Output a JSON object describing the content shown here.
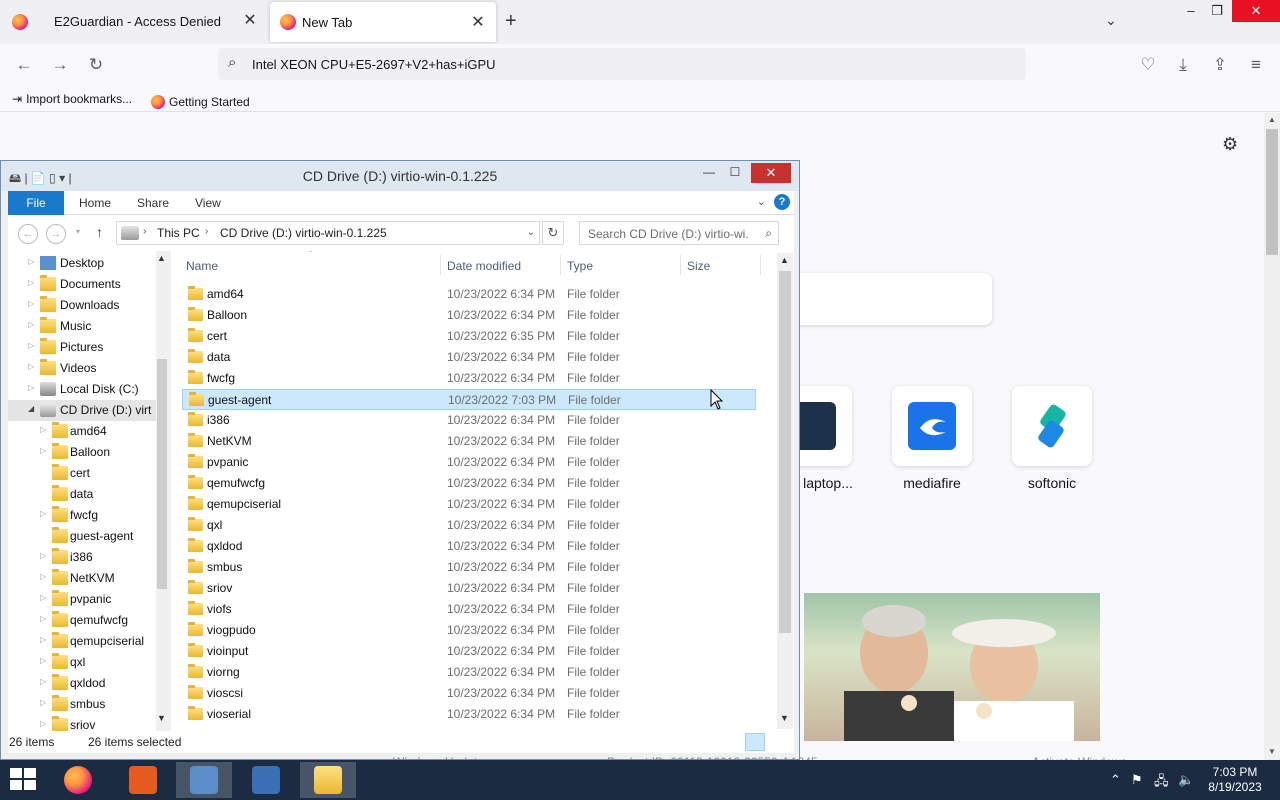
{
  "browser": {
    "tabs": [
      {
        "title": "E2Guardian - Access Denied",
        "active": false
      },
      {
        "title": "New Tab",
        "active": true
      }
    ],
    "new_tab": "+",
    "address": "Intel XEON CPU+E5-2697+V2+has+iGPU",
    "bookmarks": [
      {
        "label": "Import bookmarks..."
      },
      {
        "label": "Getting Started"
      }
    ]
  },
  "newtab_page": {
    "shortcuts": [
      {
        "label": "laptop...",
        "color": "#1d3049"
      },
      {
        "label": "mediafire",
        "color": "#1a73e8"
      },
      {
        "label": "softonic",
        "color": "#16b7a2"
      }
    ],
    "footer_left": "Windows Update",
    "footer_mid": "Product ID: 00118-10010-32552-AA245",
    "footer_right": "Activate Windows"
  },
  "explorer": {
    "title": "CD Drive (D:) virtio-win-0.1.225",
    "ribbon_tabs": [
      "File",
      "Home",
      "Share",
      "View"
    ],
    "breadcrumb": [
      "This PC",
      "CD Drive (D:) virtio-win-0.1.225"
    ],
    "search_placeholder": "Search CD Drive (D:) virtio-wi...",
    "nav_top": [
      {
        "label": "Desktop"
      },
      {
        "label": "Documents"
      },
      {
        "label": "Downloads"
      },
      {
        "label": "Music"
      },
      {
        "label": "Pictures"
      },
      {
        "label": "Videos"
      },
      {
        "label": "Local Disk (C:)"
      },
      {
        "label": "CD Drive (D:) virt"
      }
    ],
    "nav_children": [
      {
        "label": "amd64"
      },
      {
        "label": "Balloon"
      },
      {
        "label": "cert"
      },
      {
        "label": "data"
      },
      {
        "label": "fwcfg"
      },
      {
        "label": "guest-agent"
      },
      {
        "label": "i386"
      },
      {
        "label": "NetKVM"
      },
      {
        "label": "pvpanic"
      },
      {
        "label": "qemufwcfg"
      },
      {
        "label": "qemupciserial"
      },
      {
        "label": "qxl"
      },
      {
        "label": "qxldod"
      },
      {
        "label": "smbus"
      },
      {
        "label": "sriov"
      }
    ],
    "columns": [
      "Name",
      "Date modified",
      "Type",
      "Size"
    ],
    "files": [
      {
        "name": "amd64",
        "date": "10/23/2022 6:34 PM",
        "type": "File folder"
      },
      {
        "name": "Balloon",
        "date": "10/23/2022 6:34 PM",
        "type": "File folder"
      },
      {
        "name": "cert",
        "date": "10/23/2022 6:35 PM",
        "type": "File folder"
      },
      {
        "name": "data",
        "date": "10/23/2022 6:34 PM",
        "type": "File folder"
      },
      {
        "name": "fwcfg",
        "date": "10/23/2022 6:34 PM",
        "type": "File folder"
      },
      {
        "name": "guest-agent",
        "date": "10/23/2022 7:03 PM",
        "type": "File folder",
        "selected": true
      },
      {
        "name": "i386",
        "date": "10/23/2022 6:34 PM",
        "type": "File folder"
      },
      {
        "name": "NetKVM",
        "date": "10/23/2022 6:34 PM",
        "type": "File folder"
      },
      {
        "name": "pvpanic",
        "date": "10/23/2022 6:34 PM",
        "type": "File folder"
      },
      {
        "name": "qemufwcfg",
        "date": "10/23/2022 6:34 PM",
        "type": "File folder"
      },
      {
        "name": "qemupciserial",
        "date": "10/23/2022 6:34 PM",
        "type": "File folder"
      },
      {
        "name": "qxl",
        "date": "10/23/2022 6:34 PM",
        "type": "File folder"
      },
      {
        "name": "qxldod",
        "date": "10/23/2022 6:34 PM",
        "type": "File folder"
      },
      {
        "name": "smbus",
        "date": "10/23/2022 6:34 PM",
        "type": "File folder"
      },
      {
        "name": "sriov",
        "date": "10/23/2022 6:34 PM",
        "type": "File folder"
      },
      {
        "name": "viofs",
        "date": "10/23/2022 6:34 PM",
        "type": "File folder"
      },
      {
        "name": "viogpudo",
        "date": "10/23/2022 6:34 PM",
        "type": "File folder"
      },
      {
        "name": "vioinput",
        "date": "10/23/2022 6:34 PM",
        "type": "File folder"
      },
      {
        "name": "viorng",
        "date": "10/23/2022 6:34 PM",
        "type": "File folder"
      },
      {
        "name": "vioscsi",
        "date": "10/23/2022 6:34 PM",
        "type": "File folder"
      },
      {
        "name": "vioserial",
        "date": "10/23/2022 6:34 PM",
        "type": "File folder"
      }
    ],
    "status_count": "26 items",
    "status_selected": "26 items selected"
  },
  "taskbar": {
    "time": "7:03 PM",
    "date": "8/19/2023"
  },
  "colors": {
    "selection_bg": "#cce8ff",
    "file_tab": "#1979ca",
    "close_red": "#c7302c",
    "taskbar": "#1a2b42"
  }
}
